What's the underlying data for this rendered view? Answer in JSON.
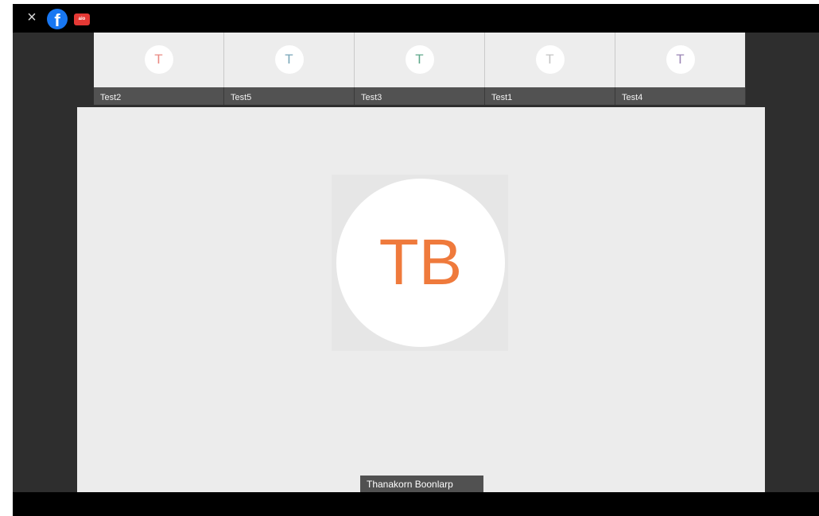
{
  "topbar": {
    "close_glyph": "×",
    "facebook_glyph": "f",
    "app_badge_text": "aio",
    "icons": [
      "close-icon",
      "facebook-icon",
      "app-badge-icon"
    ]
  },
  "participants": [
    {
      "name": "Test2",
      "initial": "T",
      "color": "#e98a83"
    },
    {
      "name": "Test5",
      "initial": "T",
      "color": "#79a6b8"
    },
    {
      "name": "Test3",
      "initial": "T",
      "color": "#5fa88b"
    },
    {
      "name": "Test1",
      "initial": "T",
      "color": "#c4c4c4"
    },
    {
      "name": "Test4",
      "initial": "T",
      "color": "#9b85b5"
    }
  ],
  "main": {
    "initials": "TB",
    "name": "Thanakorn Boonlarp",
    "accent_color": "#ef7a3c"
  }
}
